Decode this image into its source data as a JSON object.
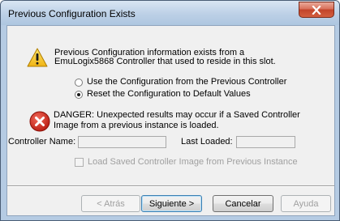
{
  "dialog": {
    "title": "Previous Configuration Exists",
    "close_label": "x"
  },
  "info": {
    "line1": "Previous Configuration information exists from a",
    "line2": "EmuLogix5868 Controller that used to reside in this slot."
  },
  "options": {
    "use_previous": "Use the Configuration from the Previous Controller",
    "reset_default": "Reset the Configuration to Default Values",
    "selected": "reset_default"
  },
  "danger": {
    "line1": "DANGER:  Unexpected results may occur if a Saved Controller",
    "line2": "Image from a previous instance is loaded."
  },
  "fields": {
    "controller_name_label": "Controller Name:",
    "controller_name_value": "",
    "last_loaded_label": "Last Loaded:",
    "last_loaded_value": ""
  },
  "load_saved": {
    "label": "Load Saved Controller Image from Previous Instance",
    "checked": false
  },
  "buttons": {
    "back": "< Atrás",
    "next": "Siguiente >",
    "cancel": "Cancelar",
    "help": "Ayuda"
  },
  "colors": {
    "warning_yellow": "#f2c21a",
    "danger_red": "#d62b1f",
    "close_red": "#c2442a"
  },
  "icons": {
    "warning": "warning-icon",
    "danger": "error-icon",
    "close": "close-icon"
  }
}
